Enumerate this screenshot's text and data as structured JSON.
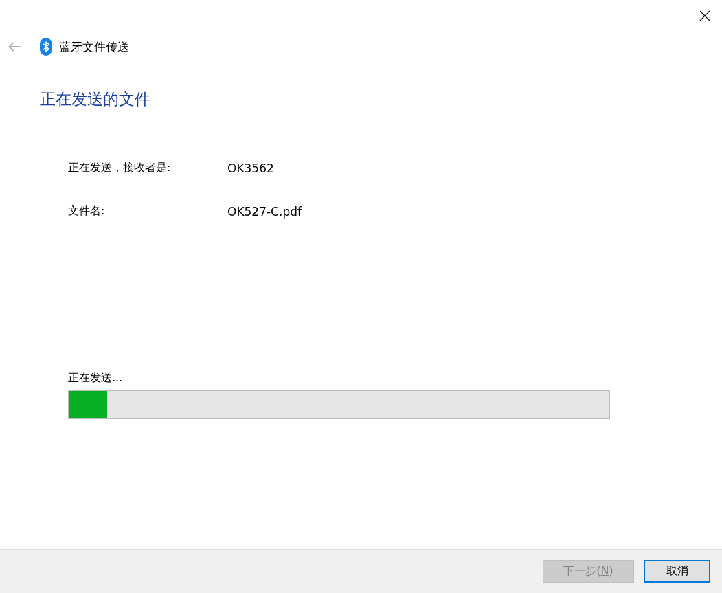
{
  "window": {
    "title": "蓝牙文件传送"
  },
  "heading": "正在发送的文件",
  "details": [
    {
      "label": "正在发送，接收者是:",
      "value": "OK3562"
    },
    {
      "label": "文件名:",
      "value": "OK527-C.pdf"
    }
  ],
  "progress": {
    "label": "正在发送...",
    "level": 0.071
  },
  "buttons": [
    {
      "label_before": "下一步(",
      "access_key": "N",
      "label_after": ")",
      "disabled": true,
      "focused": false
    },
    {
      "label_before": "取消",
      "disabled": false,
      "focused": true
    }
  ]
}
